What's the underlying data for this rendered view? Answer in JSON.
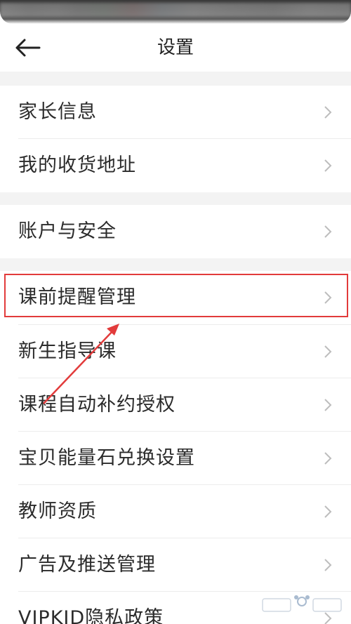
{
  "header": {
    "title": "设置"
  },
  "sections": [
    {
      "items": [
        {
          "label": "家长信息"
        },
        {
          "label": "我的收货地址"
        }
      ]
    },
    {
      "items": [
        {
          "label": "账户与安全"
        }
      ]
    },
    {
      "items": [
        {
          "label": "课前提醒管理"
        },
        {
          "label": "新生指导课"
        },
        {
          "label": "课程自动补约授权"
        },
        {
          "label": "宝贝能量石兑换设置"
        },
        {
          "label": "教师资质"
        },
        {
          "label": "广告及推送管理"
        },
        {
          "label": "VIPKID隐私政策"
        }
      ]
    }
  ],
  "colors": {
    "highlight": "#e23b3b",
    "gap": "#f3f3f3",
    "text": "#2b2b2b",
    "chevron": "#bdbdbd"
  },
  "icons": {
    "back": "arrow-left-icon",
    "chevron": "chevron-right-icon"
  }
}
